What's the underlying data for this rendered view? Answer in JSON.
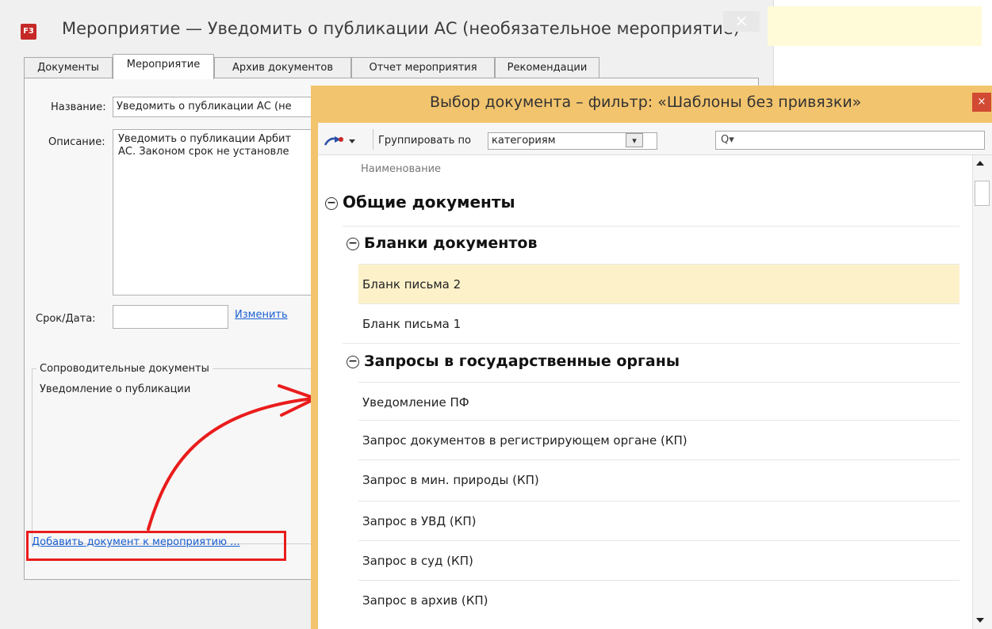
{
  "main_window": {
    "title": "Мероприятие — Уведомить о публикации АС (необязательное мероприятие)",
    "app_icon_text": "F3",
    "close_glyph": "×",
    "tabs": [
      {
        "label": "Документы"
      },
      {
        "label": "Мероприятие"
      },
      {
        "label": "Архив документов"
      },
      {
        "label": "Отчет мероприятия"
      },
      {
        "label": "Рекомендации"
      }
    ],
    "active_tab": "Мероприятие",
    "form": {
      "name_label": "Название:",
      "name_value": "Уведомить о публикации АС (не",
      "description_label": "Описание:",
      "description_line1": "Уведомить о публикации Арбит",
      "description_line2": "АС. Законом срок не установле",
      "date_label": "Срок/Дата:",
      "date_value": "",
      "change_link": "Изменить",
      "attached_group_label": "Сопроводительные документы",
      "attached_item": "Уведомление о публикации",
      "add_document_link": "Добавить документ к мероприятию ..."
    },
    "colors": {
      "highlight_frame": "#ea1c1c",
      "arrow": "#ea1c1c"
    }
  },
  "dialog": {
    "title": "Выбор документа – фильтр: «Шаблоны без привязки»",
    "close_glyph": "×",
    "toolbar": {
      "group_by_label": "Группировать по",
      "group_by_value": "категориям",
      "combo_arrow": "▾",
      "search_placeholder": "Q▾"
    },
    "column_header": "Наименование",
    "tree": {
      "root": {
        "label": "Общие документы",
        "toggle": "−"
      },
      "groups": [
        {
          "label": "Бланки документов",
          "toggle": "−",
          "items": [
            "Бланк письма 2",
            "Бланк письма 1"
          ]
        },
        {
          "label": "Запросы в государственные органы",
          "toggle": "−",
          "items": [
            "Уведомление ПФ",
            "Запрос документов в регистрирующем органе (КП)",
            "Запрос в мин. природы (КП)",
            "Запрос в УВД (КП)",
            "Запрос в суд (КП)",
            "Запрос в архив (КП)"
          ]
        }
      ],
      "selected_item": "Бланк письма 2"
    },
    "colors": {
      "frame": "#f2c46d",
      "selected_row": "#fdf1c9",
      "close_button": "#d24a33"
    }
  }
}
